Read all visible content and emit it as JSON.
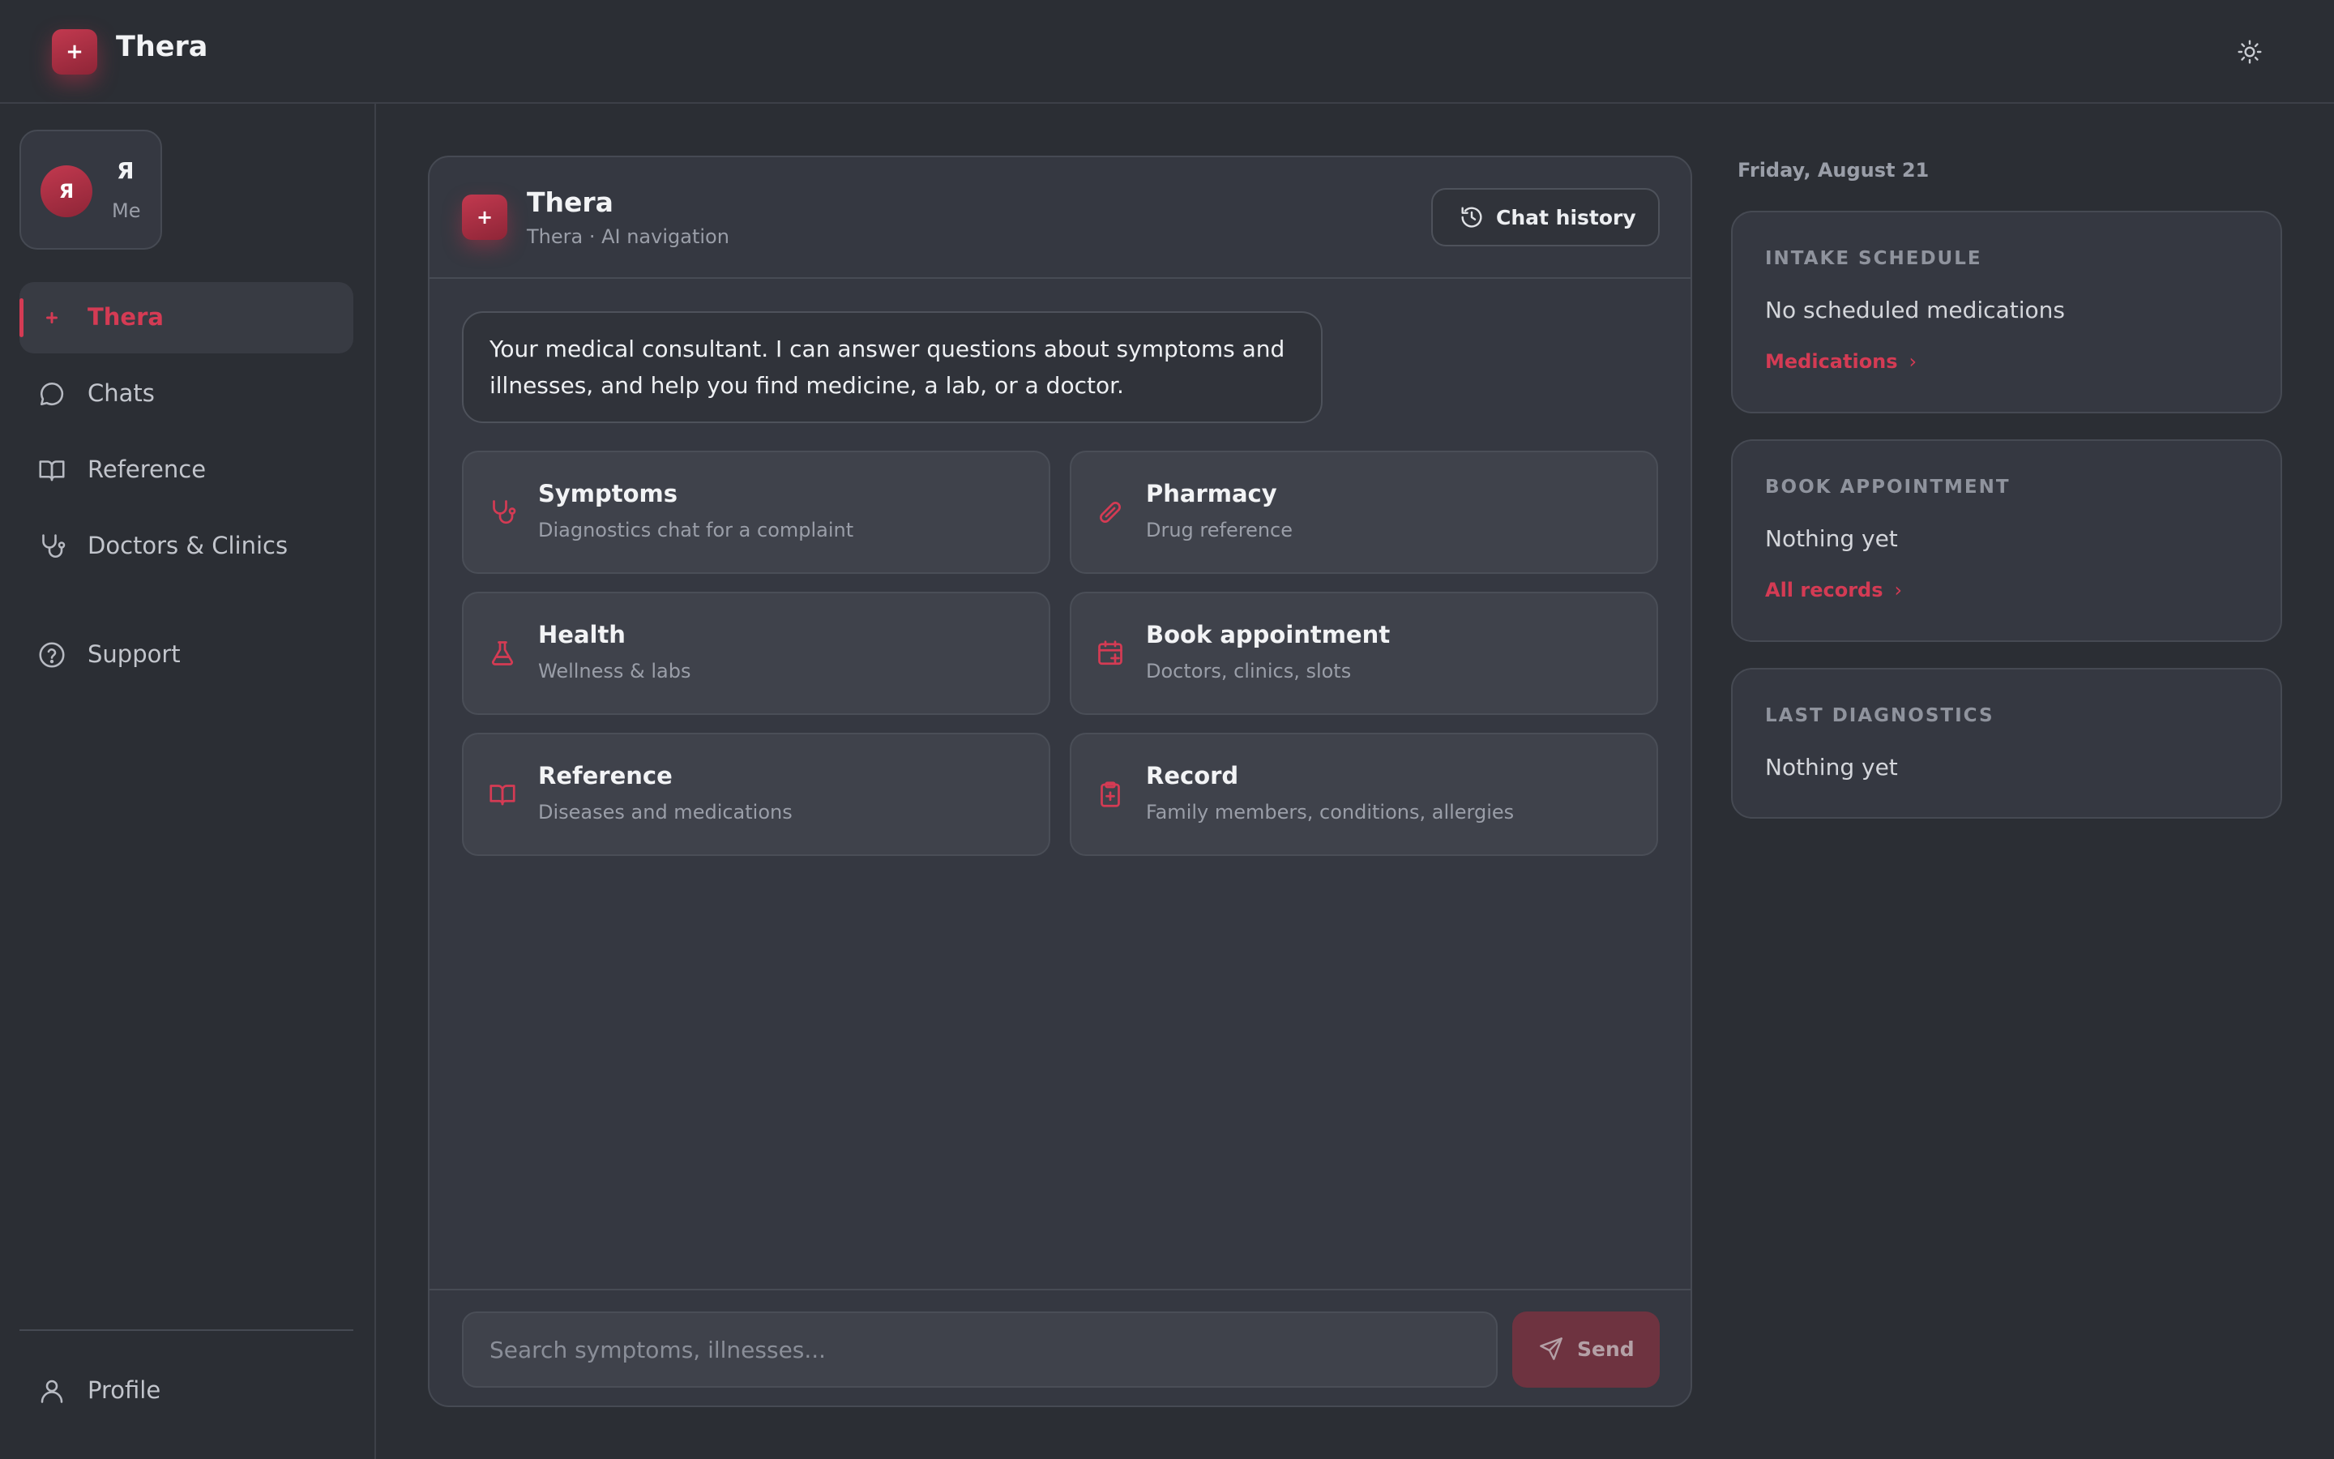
{
  "app": {
    "name": "Thera",
    "logo_glyph": "+"
  },
  "topbar": {
    "theme_icon": "sun-icon"
  },
  "user": {
    "avatar_initial": "Я",
    "name": "Я",
    "subtitle": "Me"
  },
  "sidebar": {
    "items": [
      {
        "label": "Thera",
        "icon": "plus-icon",
        "active": true
      },
      {
        "label": "Chats",
        "icon": "chat-bubble-icon"
      },
      {
        "label": "Reference",
        "icon": "book-icon"
      },
      {
        "label": "Doctors & Clinics",
        "icon": "stethoscope-icon"
      },
      {
        "label": "Support",
        "icon": "help-circle-icon"
      }
    ],
    "profile": {
      "label": "Profile",
      "icon": "user-icon"
    }
  },
  "chat": {
    "title": "Thera",
    "subtitle": "Thera · AI navigation",
    "history_button": "Chat history",
    "greeting": "Your medical consultant. I can answer questions about symptoms and illnesses, and help you find medicine, a lab, or a doctor.",
    "cards": [
      {
        "title": "Symptoms",
        "subtitle": "Diagnostics chat for a complaint",
        "icon": "stethoscope-icon"
      },
      {
        "title": "Pharmacy",
        "subtitle": "Drug reference",
        "icon": "pill-icon"
      },
      {
        "title": "Health",
        "subtitle": "Wellness & labs",
        "icon": "flask-icon"
      },
      {
        "title": "Book appointment",
        "subtitle": "Doctors, clinics, slots",
        "icon": "calendar-plus-icon"
      },
      {
        "title": "Reference",
        "subtitle": "Diseases and medications",
        "icon": "book-icon"
      },
      {
        "title": "Record",
        "subtitle": "Family members, conditions, allergies",
        "icon": "clipboard-plus-icon"
      }
    ],
    "input": {
      "placeholder": "Search symptoms, illnesses...",
      "value": ""
    },
    "send_button": "Send"
  },
  "right_panel": {
    "date": "Friday, August 21",
    "cards": [
      {
        "heading": "INTAKE SCHEDULE",
        "text": "No scheduled medications",
        "link": "Medications",
        "chevron": "›"
      },
      {
        "heading": "BOOK APPOINTMENT",
        "text": "Nothing yet",
        "link": "All records",
        "chevron": "›"
      },
      {
        "heading": "LAST DIAGNOSTICS",
        "text": "Nothing yet"
      }
    ]
  },
  "colors": {
    "accent": "#d43b54",
    "background": "#2b2e34",
    "panel": "#353841",
    "card": "#3f424b"
  }
}
